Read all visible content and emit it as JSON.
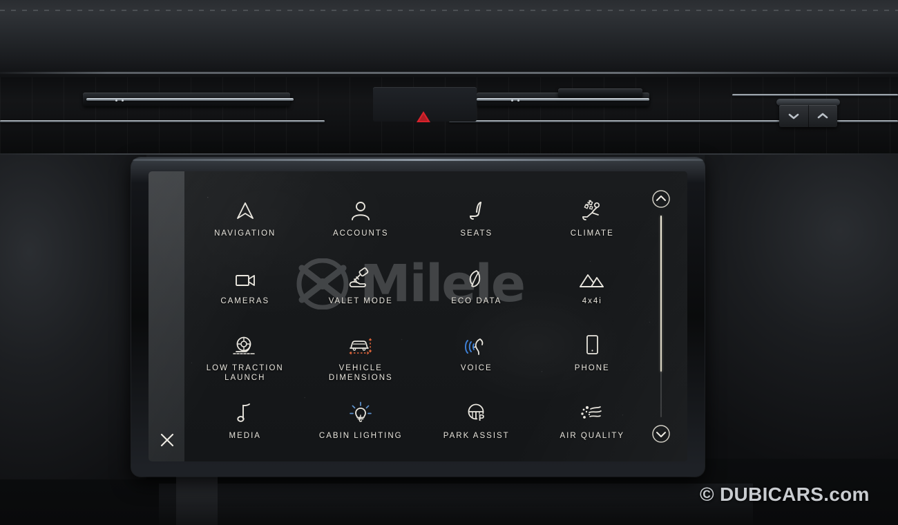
{
  "scene": {
    "kind": "vehicle-infotainment-photo",
    "watermark_center": "Milele",
    "watermark_corner": "© DUBICARS.com"
  },
  "dashboard": {
    "hazard_button": {
      "name": "hazard-warning-button",
      "color": "#e8252e"
    },
    "climate_seat_buttons": [
      {
        "name": "chevron-down-button",
        "glyph": "chevron-down"
      },
      {
        "name": "chevron-up-button",
        "glyph": "chevron-up"
      }
    ]
  },
  "screen": {
    "background": "#16181a",
    "icon_color": "#e9e6de",
    "accent_orange": "#e2663a",
    "accent_blue": "#3e7fd4",
    "scrollbar": {
      "thumb_color": "#f0ead8",
      "track_color": "rgba(255,255,255,0.16)",
      "up_label": "scroll-up",
      "down_label": "scroll-down"
    },
    "close_button_label": "close",
    "menu": {
      "rows": 4,
      "columns": 4,
      "items": [
        {
          "label": "NAVIGATION",
          "icon": "navigation-arrow-icon"
        },
        {
          "label": "ACCOUNTS",
          "icon": "person-icon"
        },
        {
          "label": "SEATS",
          "icon": "seat-icon"
        },
        {
          "label": "CLIMATE",
          "icon": "climate-seated-airflow-icon"
        },
        {
          "label": "CAMERAS",
          "icon": "video-camera-icon"
        },
        {
          "label": "VALET MODE",
          "icon": "key-handover-icon"
        },
        {
          "label": "ECO DATA",
          "icon": "leaf-icon"
        },
        {
          "label": "4x4i",
          "icon": "mountains-icon"
        },
        {
          "label": "LOW TRACTION\nLAUNCH",
          "icon": "tire-traction-icon"
        },
        {
          "label": "VEHICLE\nDIMENSIONS",
          "icon": "car-dimensions-icon"
        },
        {
          "label": "VOICE",
          "icon": "voice-speaking-head-icon"
        },
        {
          "label": "PHONE",
          "icon": "phone-handset-icon"
        },
        {
          "label": "MEDIA",
          "icon": "music-note-icon"
        },
        {
          "label": "CABIN LIGHTING",
          "icon": "light-bulb-icon"
        },
        {
          "label": "PARK ASSIST",
          "icon": "steering-wheel-p-icon"
        },
        {
          "label": "AIR QUALITY",
          "icon": "air-particles-icon"
        }
      ]
    }
  }
}
